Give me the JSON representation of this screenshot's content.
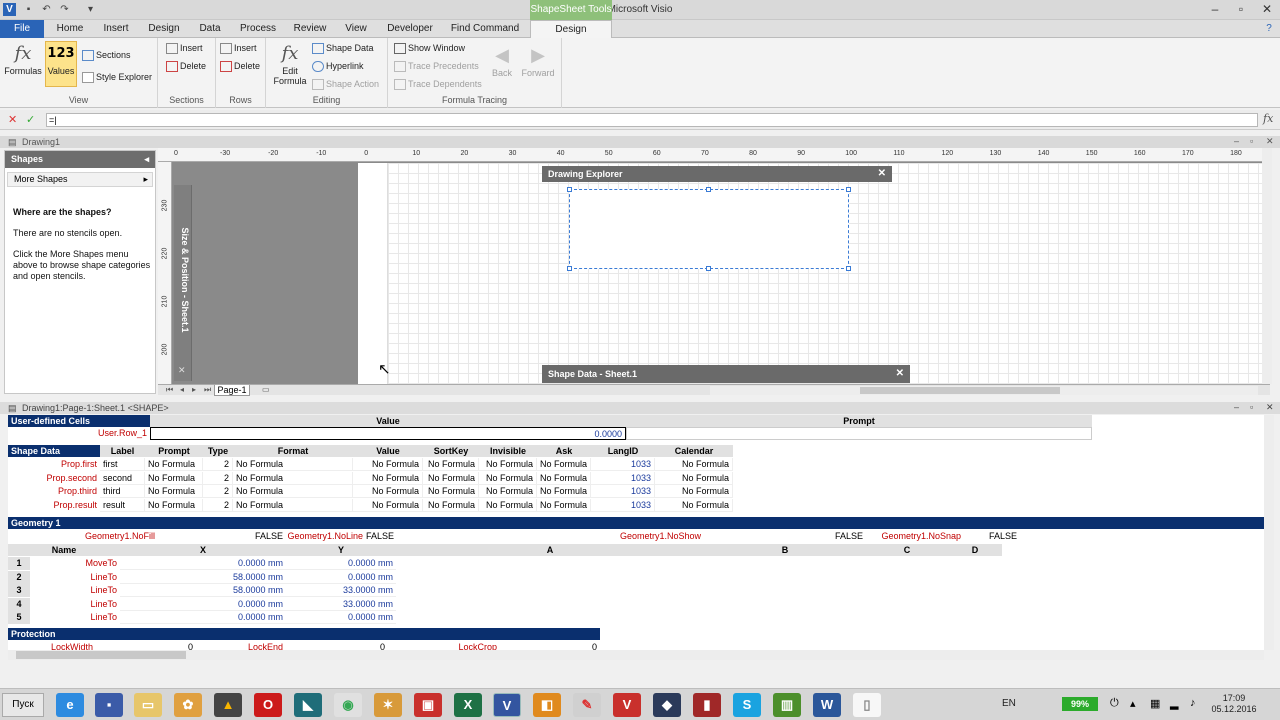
{
  "app": {
    "title": "Microsoft Visio",
    "contextual_group": "ShapeSheet Tools",
    "tabs": [
      "File",
      "Home",
      "Insert",
      "Design",
      "Data",
      "Process",
      "Review",
      "View",
      "Developer",
      "Find Command",
      "Design"
    ]
  },
  "ribbon": {
    "view": {
      "label": "View",
      "formulas": "Formulas",
      "values": "Values",
      "sections": "Sections",
      "style_explorer": "Style Explorer"
    },
    "sections": {
      "label": "Sections",
      "insert": "Insert",
      "delete": "Delete"
    },
    "rows": {
      "label": "Rows",
      "insert": "Insert",
      "delete": "Delete"
    },
    "editing": {
      "label": "Editing",
      "edit_formula_1": "Edit",
      "edit_formula_2": "Formula",
      "shape_data": "Shape Data",
      "hyperlink": "Hyperlink",
      "shape_action": "Shape Action"
    },
    "tracing": {
      "label": "Formula Tracing",
      "show_window": "Show Window",
      "trace_precedents": "Trace Precedents",
      "trace_dependents": "Trace Dependents",
      "back": "Back",
      "forward": "Forward"
    }
  },
  "formula_bar": {
    "value": "=|"
  },
  "document": {
    "title": "Drawing1"
  },
  "shapes_panel": {
    "title": "Shapes",
    "more_shapes": "More Shapes",
    "heading": "Where are the shapes?",
    "line1": "There are no stencils open.",
    "line2": "Click the More Shapes menu above to browse shape categories and open stencils."
  },
  "rulers": {
    "top": [
      "-30",
      "-20",
      "-10",
      "0",
      "10",
      "20",
      "30",
      "40",
      "50",
      "60",
      "70",
      "80",
      "90",
      "100",
      "110",
      "120",
      "130",
      "140",
      "150",
      "160",
      "170",
      "180"
    ],
    "top_left": "0",
    "left": [
      "230",
      "220",
      "210",
      "200"
    ]
  },
  "size_position_label": "Size & Position - Sheet.1",
  "windows": {
    "drawing_explorer": "Drawing Explorer",
    "shape_data": "Shape Data - Sheet.1"
  },
  "page_tab": "Page-1",
  "shapesheet": {
    "title": "Drawing1:Page-1:Sheet.1 <SHAPE>",
    "user_defined": {
      "section": "User-defined Cells",
      "col_value": "Value",
      "col_prompt": "Prompt",
      "row_name": "User.Row_1",
      "row_value": "0.0000"
    },
    "shape_data": {
      "section": "Shape Data",
      "headers": [
        "Label",
        "Prompt",
        "Type",
        "Format",
        "Value",
        "SortKey",
        "Invisible",
        "Ask",
        "LangID",
        "Calendar"
      ],
      "rows": [
        {
          "name": "Prop.first",
          "label": "first",
          "prompt": "No Formula",
          "type": "2",
          "format": "No Formula",
          "value": "No Formula",
          "sortkey": "No Formula",
          "invisible": "No Formula",
          "ask": "No Formula",
          "langid": "1033",
          "calendar": "No Formula"
        },
        {
          "name": "Prop.second",
          "label": "second",
          "prompt": "No Formula",
          "type": "2",
          "format": "No Formula",
          "value": "No Formula",
          "sortkey": "No Formula",
          "invisible": "No Formula",
          "ask": "No Formula",
          "langid": "1033",
          "calendar": "No Formula"
        },
        {
          "name": "Prop.third",
          "label": "third",
          "prompt": "No Formula",
          "type": "2",
          "format": "No Formula",
          "value": "No Formula",
          "sortkey": "No Formula",
          "invisible": "No Formula",
          "ask": "No Formula",
          "langid": "1033",
          "calendar": "No Formula"
        },
        {
          "name": "Prop.result",
          "label": "result",
          "prompt": "No Formula",
          "type": "2",
          "format": "No Formula",
          "value": "No Formula",
          "sortkey": "No Formula",
          "invisible": "No Formula",
          "ask": "No Formula",
          "langid": "1033",
          "calendar": "No Formula"
        }
      ]
    },
    "geometry": {
      "section": "Geometry 1",
      "nofill_name": "Geometry1.NoFill",
      "nofill_value": "FALSE",
      "noline_name": "Geometry1.NoLine",
      "noline_value": "FALSE",
      "noshow_name": "Geometry1.NoShow",
      "noshow_value": "FALSE",
      "nosnap_name": "Geometry1.NoSnap",
      "nosnap_value": "FALSE",
      "headers": [
        "Name",
        "X",
        "Y",
        "A",
        "B",
        "C",
        "D"
      ],
      "rows": [
        {
          "n": "1",
          "name": "MoveTo",
          "x": "0.0000 mm",
          "y": "0.0000 mm"
        },
        {
          "n": "2",
          "name": "LineTo",
          "x": "58.0000 mm",
          "y": "0.0000 mm"
        },
        {
          "n": "3",
          "name": "LineTo",
          "x": "58.0000 mm",
          "y": "33.0000 mm"
        },
        {
          "n": "4",
          "name": "LineTo",
          "x": "0.0000 mm",
          "y": "33.0000 mm"
        },
        {
          "n": "5",
          "name": "LineTo",
          "x": "0.0000 mm",
          "y": "0.0000 mm"
        }
      ]
    },
    "protection": {
      "section": "Protection",
      "lockwidth": "LockWidth",
      "lockwidth_v": "0",
      "lockend": "LockEnd",
      "lockend_v": "0",
      "lockcrop": "LockCrop",
      "lockcrop_v": "0"
    }
  },
  "taskbar": {
    "start": "Пуск",
    "lang": "EN",
    "battery": "99%",
    "time": "17:09",
    "date": "05.12.2016"
  },
  "colors": {
    "file_tab": "#2a64b7",
    "context_group": "#8ec07a",
    "section_header": "#0a2f6e",
    "row_name": "#c00000"
  }
}
